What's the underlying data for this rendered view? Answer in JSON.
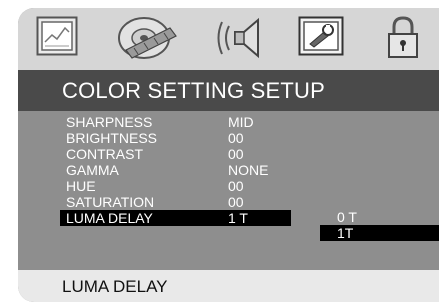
{
  "menu": {
    "title": "COLOR SETTING SETUP",
    "tabs": [
      {
        "icon": "general-setup-icon"
      },
      {
        "icon": "video-setup-icon"
      },
      {
        "icon": "audio-setup-icon"
      },
      {
        "icon": "preference-setup-icon"
      },
      {
        "icon": "password-lock-icon"
      }
    ],
    "selected_tab_index": 3
  },
  "settings": [
    {
      "label": "SHARPNESS",
      "value": "MID"
    },
    {
      "label": "BRIGHTNESS",
      "value": "00"
    },
    {
      "label": "CONTRAST",
      "value": "00"
    },
    {
      "label": "GAMMA",
      "value": "NONE"
    },
    {
      "label": "HUE",
      "value": "00"
    },
    {
      "label": "SATURATION",
      "value": "00"
    },
    {
      "label": "LUMA DELAY",
      "value": "1 T"
    }
  ],
  "selected_setting_index": 6,
  "options": [
    {
      "text": "0 T"
    },
    {
      "text": "1T"
    }
  ],
  "selected_option_index": 1,
  "status": {
    "text": "LUMA DELAY"
  },
  "colors": {
    "background": "#8e8e8e",
    "icon_bar": "#d6d6d6",
    "title_bar": "#4a4a4a",
    "highlight": "#000000",
    "status_bar": "#e9e9e9",
    "text": "#ffffff"
  }
}
